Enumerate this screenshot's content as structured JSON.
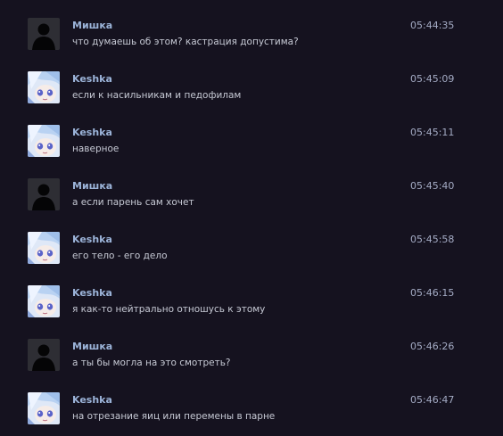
{
  "messages": [
    {
      "author": "Мишка",
      "avatar": "silhouette-icon",
      "text": "что думаешь об этом? кастрация допустима?",
      "time": "05:44:35"
    },
    {
      "author": "Keshka",
      "avatar": "anime-girl-avatar",
      "text": "если к насильникам и педофилам",
      "time": "05:45:09"
    },
    {
      "author": "Keshka",
      "avatar": "anime-girl-avatar",
      "text": "наверное",
      "time": "05:45:11"
    },
    {
      "author": "Мишка",
      "avatar": "silhouette-icon",
      "text": "а если парень сам хочет",
      "time": "05:45:40"
    },
    {
      "author": "Keshka",
      "avatar": "anime-girl-avatar",
      "text": "его тело - его дело",
      "time": "05:45:58"
    },
    {
      "author": "Keshka",
      "avatar": "anime-girl-avatar",
      "text": "я как-то нейтрально отношусь к этому",
      "time": "05:46:15"
    },
    {
      "author": "Мишка",
      "avatar": "silhouette-icon",
      "text": "а ты бы могла на это смотреть?",
      "time": "05:46:26"
    },
    {
      "author": "Keshka",
      "avatar": "anime-girl-avatar",
      "text": "на отрезание яиц или перемены в парне",
      "time": "05:46:47"
    }
  ],
  "colors": {
    "background": "#15121f",
    "author": "#9cb4d9",
    "text": "#c6c9d4",
    "time": "#a4abc4"
  }
}
